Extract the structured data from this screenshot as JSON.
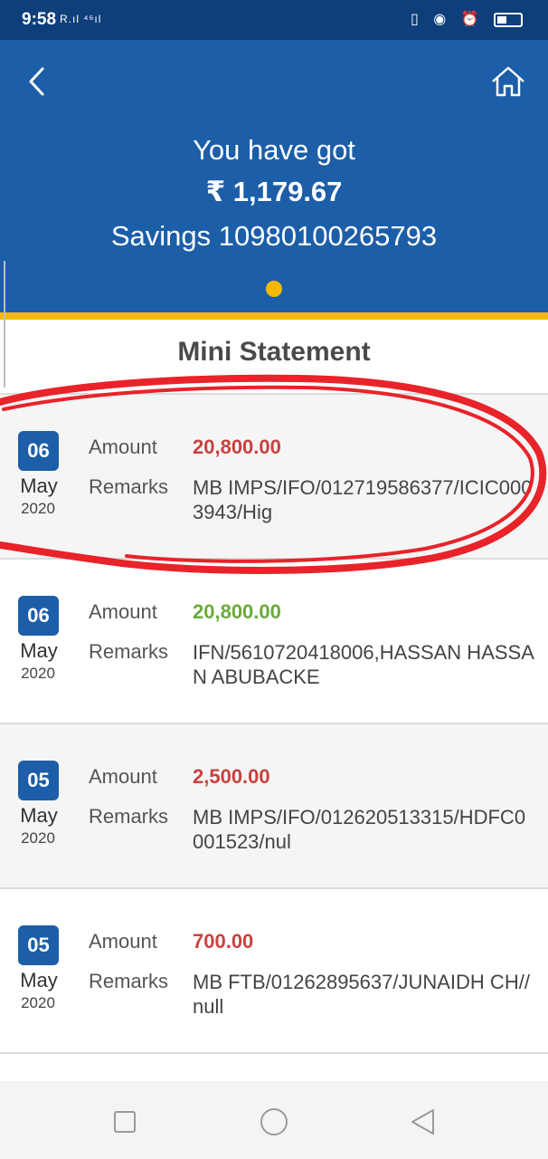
{
  "status_bar": {
    "time": "9:58",
    "signal_text": "R.ıl ⁴⁶ıl",
    "icons": [
      "vibrate-icon",
      "lock-rotation-icon",
      "alarm-icon",
      "battery-icon"
    ]
  },
  "header": {
    "back_icon": "chevron-left-icon",
    "home_icon": "home-icon",
    "greeting": "You have got",
    "balance": "₹ 1,179.67",
    "account": "Savings 10980100265793",
    "background_color": "#1c5ea8",
    "accent_color": "#f2b713"
  },
  "mini_statement": {
    "title": "Mini Statement",
    "amount_label": "Amount",
    "remarks_label": "Remarks",
    "debit_color": "#c9413e",
    "credit_color": "#6aaa3c",
    "transactions": [
      {
        "day": "06",
        "month": "May",
        "year": "2020",
        "amount": "20,800.00",
        "type": "debit",
        "remarks": "MB IMPS/IFO/012719586377/ICIC0003943/Hig"
      },
      {
        "day": "06",
        "month": "May",
        "year": "2020",
        "amount": "20,800.00",
        "type": "credit",
        "remarks": "IFN/5610720418006,HASSAN HASSAN ABUBACKE"
      },
      {
        "day": "05",
        "month": "May",
        "year": "2020",
        "amount": "2,500.00",
        "type": "debit",
        "remarks": "MB IMPS/IFO/012620513315/HDFC0001523/nul"
      },
      {
        "day": "05",
        "month": "May",
        "year": "2020",
        "amount": "700.00",
        "type": "debit",
        "remarks": "MB FTB/01262895637/JUNAIDH CH//null"
      }
    ]
  },
  "annotation": {
    "type": "hand-drawn red circle around first transaction",
    "color": "#e8232a"
  },
  "nav_bar": {
    "icons": [
      "recent-apps-icon",
      "home-circle-icon",
      "back-triangle-icon"
    ]
  }
}
